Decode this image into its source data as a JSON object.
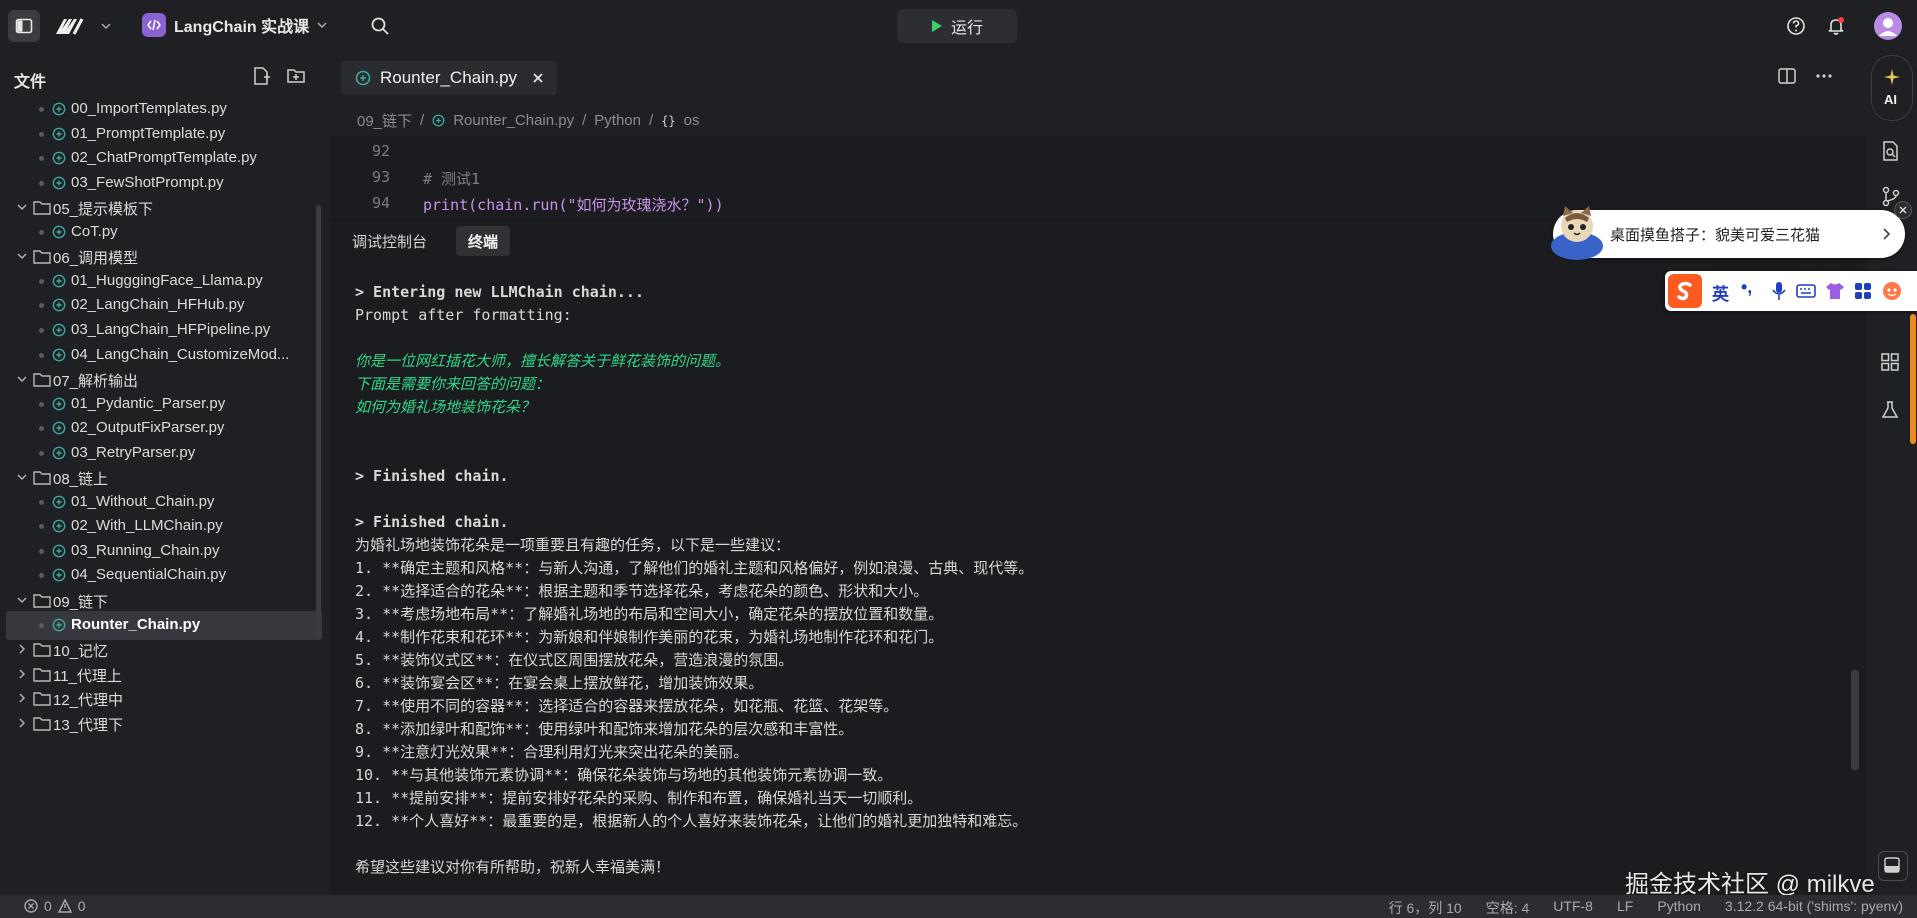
{
  "app": {
    "project_name": "LangChain 实战课",
    "run_label": "运行"
  },
  "sidebar": {
    "title": "文件",
    "tree": [
      {
        "label": "00_ImportTemplates.py",
        "type": "file",
        "depth": 2
      },
      {
        "label": "01_PromptTemplate.py",
        "type": "file",
        "depth": 2
      },
      {
        "label": "02_ChatPromptTemplate.py",
        "type": "file",
        "depth": 2
      },
      {
        "label": "03_FewShotPrompt.py",
        "type": "file",
        "depth": 2
      },
      {
        "label": "05_提示模板下",
        "type": "folder-open",
        "depth": 1
      },
      {
        "label": "CoT.py",
        "type": "file",
        "depth": 2
      },
      {
        "label": "06_调用模型",
        "type": "folder-open",
        "depth": 1
      },
      {
        "label": "01_HugggingFace_Llama.py",
        "type": "file",
        "depth": 2
      },
      {
        "label": "02_LangChain_HFHub.py",
        "type": "file",
        "depth": 2
      },
      {
        "label": "03_LangChain_HFPipeline.py",
        "type": "file",
        "depth": 2
      },
      {
        "label": "04_LangChain_CustomizeMod...",
        "type": "file",
        "depth": 2
      },
      {
        "label": "07_解析输出",
        "type": "folder-open",
        "depth": 1
      },
      {
        "label": "01_Pydantic_Parser.py",
        "type": "file",
        "depth": 2
      },
      {
        "label": "02_OutputFixParser.py",
        "type": "file",
        "depth": 2
      },
      {
        "label": "03_RetryParser.py",
        "type": "file",
        "depth": 2
      },
      {
        "label": "08_链上",
        "type": "folder-open",
        "depth": 1
      },
      {
        "label": "01_Without_Chain.py",
        "type": "file",
        "depth": 2
      },
      {
        "label": "02_With_LLMChain.py",
        "type": "file",
        "depth": 2
      },
      {
        "label": "03_Running_Chain.py",
        "type": "file",
        "depth": 2
      },
      {
        "label": "04_SequentialChain.py",
        "type": "file",
        "depth": 2
      },
      {
        "label": "09_链下",
        "type": "folder-open",
        "depth": 1
      },
      {
        "label": "Rounter_Chain.py",
        "type": "file",
        "depth": 2,
        "selected": true
      },
      {
        "label": "10_记忆",
        "type": "folder-closed",
        "depth": 1
      },
      {
        "label": "11_代理上",
        "type": "folder-closed",
        "depth": 1
      },
      {
        "label": "12_代理中",
        "type": "folder-closed",
        "depth": 1
      },
      {
        "label": "13_代理下",
        "type": "folder-closed",
        "depth": 1
      }
    ]
  },
  "editor": {
    "tab_label": "Rounter_Chain.py",
    "breadcrumb": [
      "09_链下",
      "Rounter_Chain.py",
      "Python",
      "os"
    ],
    "lines": [
      {
        "num": "92",
        "text": ""
      },
      {
        "num": "93",
        "text": "# 测试1"
      },
      {
        "num": "94",
        "text": "print(chain.run(\"如何为玫瑰浇水？\"))"
      }
    ]
  },
  "panel": {
    "tabs": [
      "调试控制台",
      "终端"
    ],
    "terminal_lines": [
      {
        "text": "> Entering new LLMChain chain...",
        "style": "bold"
      },
      {
        "text": "Prompt after formatting:",
        "style": ""
      },
      {
        "text": "",
        "style": ""
      },
      {
        "text": "你是一位网红插花大师，擅长解答关于鲜花装饰的问题。",
        "style": "green"
      },
      {
        "text": "下面是需要你来回答的问题：",
        "style": "green"
      },
      {
        "text": "如何为婚礼场地装饰花朵？",
        "style": "green"
      },
      {
        "text": "",
        "style": ""
      },
      {
        "text": "",
        "style": ""
      },
      {
        "text": "> Finished chain.",
        "style": "bold"
      },
      {
        "text": "",
        "style": ""
      },
      {
        "text": "> Finished chain.",
        "style": "bold"
      },
      {
        "text": "为婚礼场地装饰花朵是一项重要且有趣的任务，以下是一些建议：",
        "style": ""
      },
      {
        "text": "1. **确定主题和风格**：与新人沟通，了解他们的婚礼主题和风格偏好，例如浪漫、古典、现代等。",
        "style": ""
      },
      {
        "text": "2. **选择适合的花朵**：根据主题和季节选择花朵，考虑花朵的颜色、形状和大小。",
        "style": ""
      },
      {
        "text": "3. **考虑场地布局**：了解婚礼场地的布局和空间大小，确定花朵的摆放位置和数量。",
        "style": ""
      },
      {
        "text": "4. **制作花束和花环**：为新娘和伴娘制作美丽的花束，为婚礼场地制作花环和花门。",
        "style": ""
      },
      {
        "text": "5. **装饰仪式区**：在仪式区周围摆放花朵，营造浪漫的氛围。",
        "style": ""
      },
      {
        "text": "6. **装饰宴会区**：在宴会桌上摆放鲜花，增加装饰效果。",
        "style": ""
      },
      {
        "text": "7. **使用不同的容器**：选择适合的容器来摆放花朵，如花瓶、花篮、花架等。",
        "style": ""
      },
      {
        "text": "8. **添加绿叶和配饰**：使用绿叶和配饰来增加花朵的层次感和丰富性。",
        "style": ""
      },
      {
        "text": "9. **注意灯光效果**：合理利用灯光来突出花朵的美丽。",
        "style": ""
      },
      {
        "text": "10. **与其他装饰元素协调**：确保花朵装饰与场地的其他装饰元素协调一致。",
        "style": ""
      },
      {
        "text": "11. **提前安排**：提前安排好花朵的采购、制作和布置，确保婚礼当天一切顺利。",
        "style": ""
      },
      {
        "text": "12. **个人喜好**：最重要的是，根据新人的个人喜好来装饰花朵，让他们的婚礼更加独特和难忘。",
        "style": ""
      },
      {
        "text": "",
        "style": ""
      },
      {
        "text": "希望这些建议对你有所帮助，祝新人幸福美满！",
        "style": ""
      }
    ]
  },
  "rail": {
    "ai_label": "AI"
  },
  "overlays": {
    "bubble_text": "桌面摸鱼搭子：貌美可爱三花猫",
    "ime_lang": "英",
    "watermark": "掘金技术社区 @ milkve"
  },
  "status": {
    "errors": "0",
    "warnings": "0",
    "position": "行 6，列 10",
    "spaces": "空格: 4",
    "encoding": "UTF-8",
    "eol": "LF",
    "language": "Python",
    "interpreter": "3.12.2 64-bit ('shims': pyenv)"
  },
  "colors": {
    "accent": "#8a63d2",
    "terminal_green": "#2fd88a",
    "run_icon": "#3ccf6e"
  }
}
